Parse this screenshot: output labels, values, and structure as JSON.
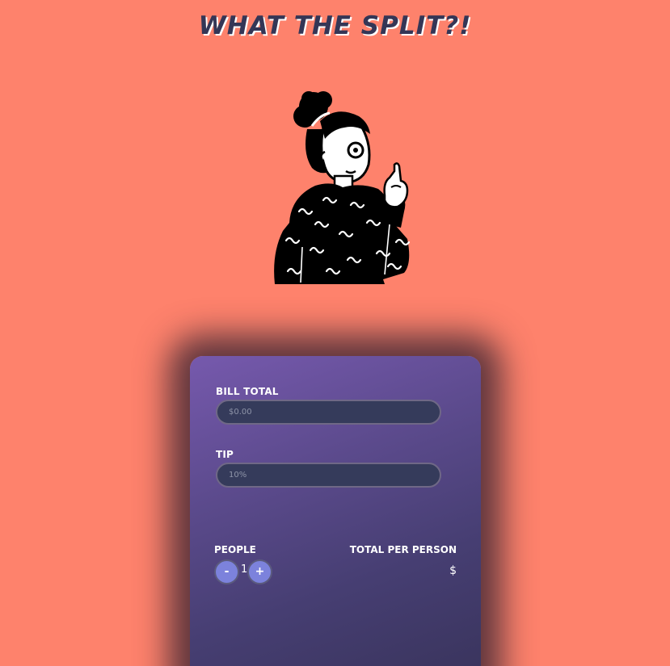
{
  "app": {
    "title": "WHAT THE SPLIT?!"
  },
  "illustration": {
    "icon": "person-pointing-up-illustration"
  },
  "form": {
    "bill_label": "BILL TOTAL",
    "bill_placeholder": "$0.00",
    "tip_label": "TIP",
    "tip_placeholder": "10%",
    "people_label": "PEOPLE",
    "decrement_label": "-",
    "increment_label": "+",
    "people_count": "1",
    "total_label": "TOTAL PER PERSON",
    "total_value": "$"
  },
  "colors": {
    "background": "#fe826c",
    "title": "#343656",
    "card_gradient_start": "#7659ad",
    "card_gradient_end": "#38335a",
    "input_bg": "#353b5b",
    "stepper_button": "#7c82dc"
  }
}
